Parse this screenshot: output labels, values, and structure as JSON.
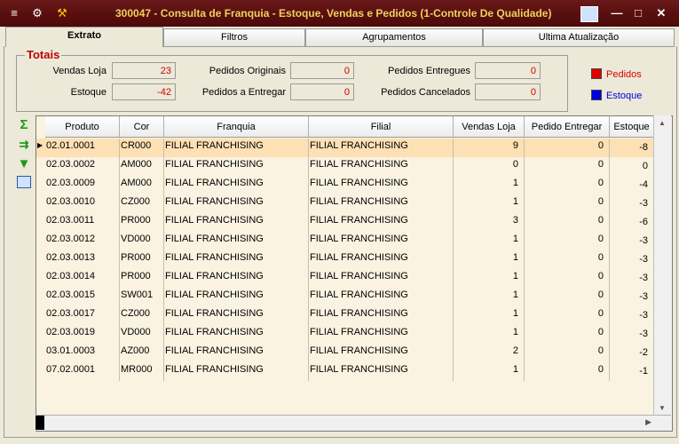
{
  "window": {
    "title": "300047 - Consulta de Franquia - Estoque, Vendas e Pedidos (1-Controle De Qualidade)",
    "minimize": "—",
    "maximize": "□",
    "close": "✕"
  },
  "tabs": [
    "Extrato",
    "Filtros",
    "Agrupamentos",
    "Ultima Atualização"
  ],
  "totais": {
    "title": "Totais",
    "vendas_loja_label": "Vendas Loja",
    "vendas_loja": "23",
    "estoque_label": "Estoque",
    "estoque": "-42",
    "pedidos_originais_label": "Pedidos Originais",
    "pedidos_originais": "0",
    "pedidos_a_entregar_label": "Pedidos a Entregar",
    "pedidos_a_entregar": "0",
    "pedidos_entregues_label": "Pedidos Entregues",
    "pedidos_entregues": "0",
    "pedidos_cancelados_label": "Pedidos Cancelados",
    "pedidos_cancelados": "0"
  },
  "legend": {
    "pedidos": "Pedidos",
    "estoque": "Estoque",
    "pedidos_color": "#e00000",
    "estoque_color": "#0000e0"
  },
  "side_icons": [
    "sum-icon",
    "export-icon",
    "download-icon",
    "image-icon"
  ],
  "grid": {
    "columns": [
      "Produto",
      "Cor",
      "Franquia",
      "Filial",
      "Vendas Loja",
      "Pedido Entregar",
      "Estoque"
    ],
    "rows": [
      [
        "02.01.0001",
        "CR000",
        "FILIAL FRANCHISING",
        "FILIAL FRANCHISING",
        "9",
        "0",
        "-8"
      ],
      [
        "02.03.0002",
        "AM000",
        "FILIAL FRANCHISING",
        "FILIAL FRANCHISING",
        "0",
        "0",
        "0"
      ],
      [
        "02.03.0009",
        "AM000",
        "FILIAL FRANCHISING",
        "FILIAL FRANCHISING",
        "1",
        "0",
        "-4"
      ],
      [
        "02.03.0010",
        "CZ000",
        "FILIAL FRANCHISING",
        "FILIAL FRANCHISING",
        "1",
        "0",
        "-3"
      ],
      [
        "02.03.0011",
        "PR000",
        "FILIAL FRANCHISING",
        "FILIAL FRANCHISING",
        "3",
        "0",
        "-6"
      ],
      [
        "02.03.0012",
        "VD000",
        "FILIAL FRANCHISING",
        "FILIAL FRANCHISING",
        "1",
        "0",
        "-3"
      ],
      [
        "02.03.0013",
        "PR000",
        "FILIAL FRANCHISING",
        "FILIAL FRANCHISING",
        "1",
        "0",
        "-3"
      ],
      [
        "02.03.0014",
        "PR000",
        "FILIAL FRANCHISING",
        "FILIAL FRANCHISING",
        "1",
        "0",
        "-3"
      ],
      [
        "02.03.0015",
        "SW001",
        "FILIAL FRANCHISING",
        "FILIAL FRANCHISING",
        "1",
        "0",
        "-3"
      ],
      [
        "02.03.0017",
        "CZ000",
        "FILIAL FRANCHISING",
        "FILIAL FRANCHISING",
        "1",
        "0",
        "-3"
      ],
      [
        "02.03.0019",
        "VD000",
        "FILIAL FRANCHISING",
        "FILIAL FRANCHISING",
        "1",
        "0",
        "-3"
      ],
      [
        "03.01.0003",
        "AZ000",
        "FILIAL FRANCHISING",
        "FILIAL FRANCHISING",
        "2",
        "0",
        "-2"
      ],
      [
        "07.02.0001",
        "MR000",
        "FILIAL FRANCHISING",
        "FILIAL FRANCHISING",
        "1",
        "0",
        "-1"
      ]
    ]
  }
}
